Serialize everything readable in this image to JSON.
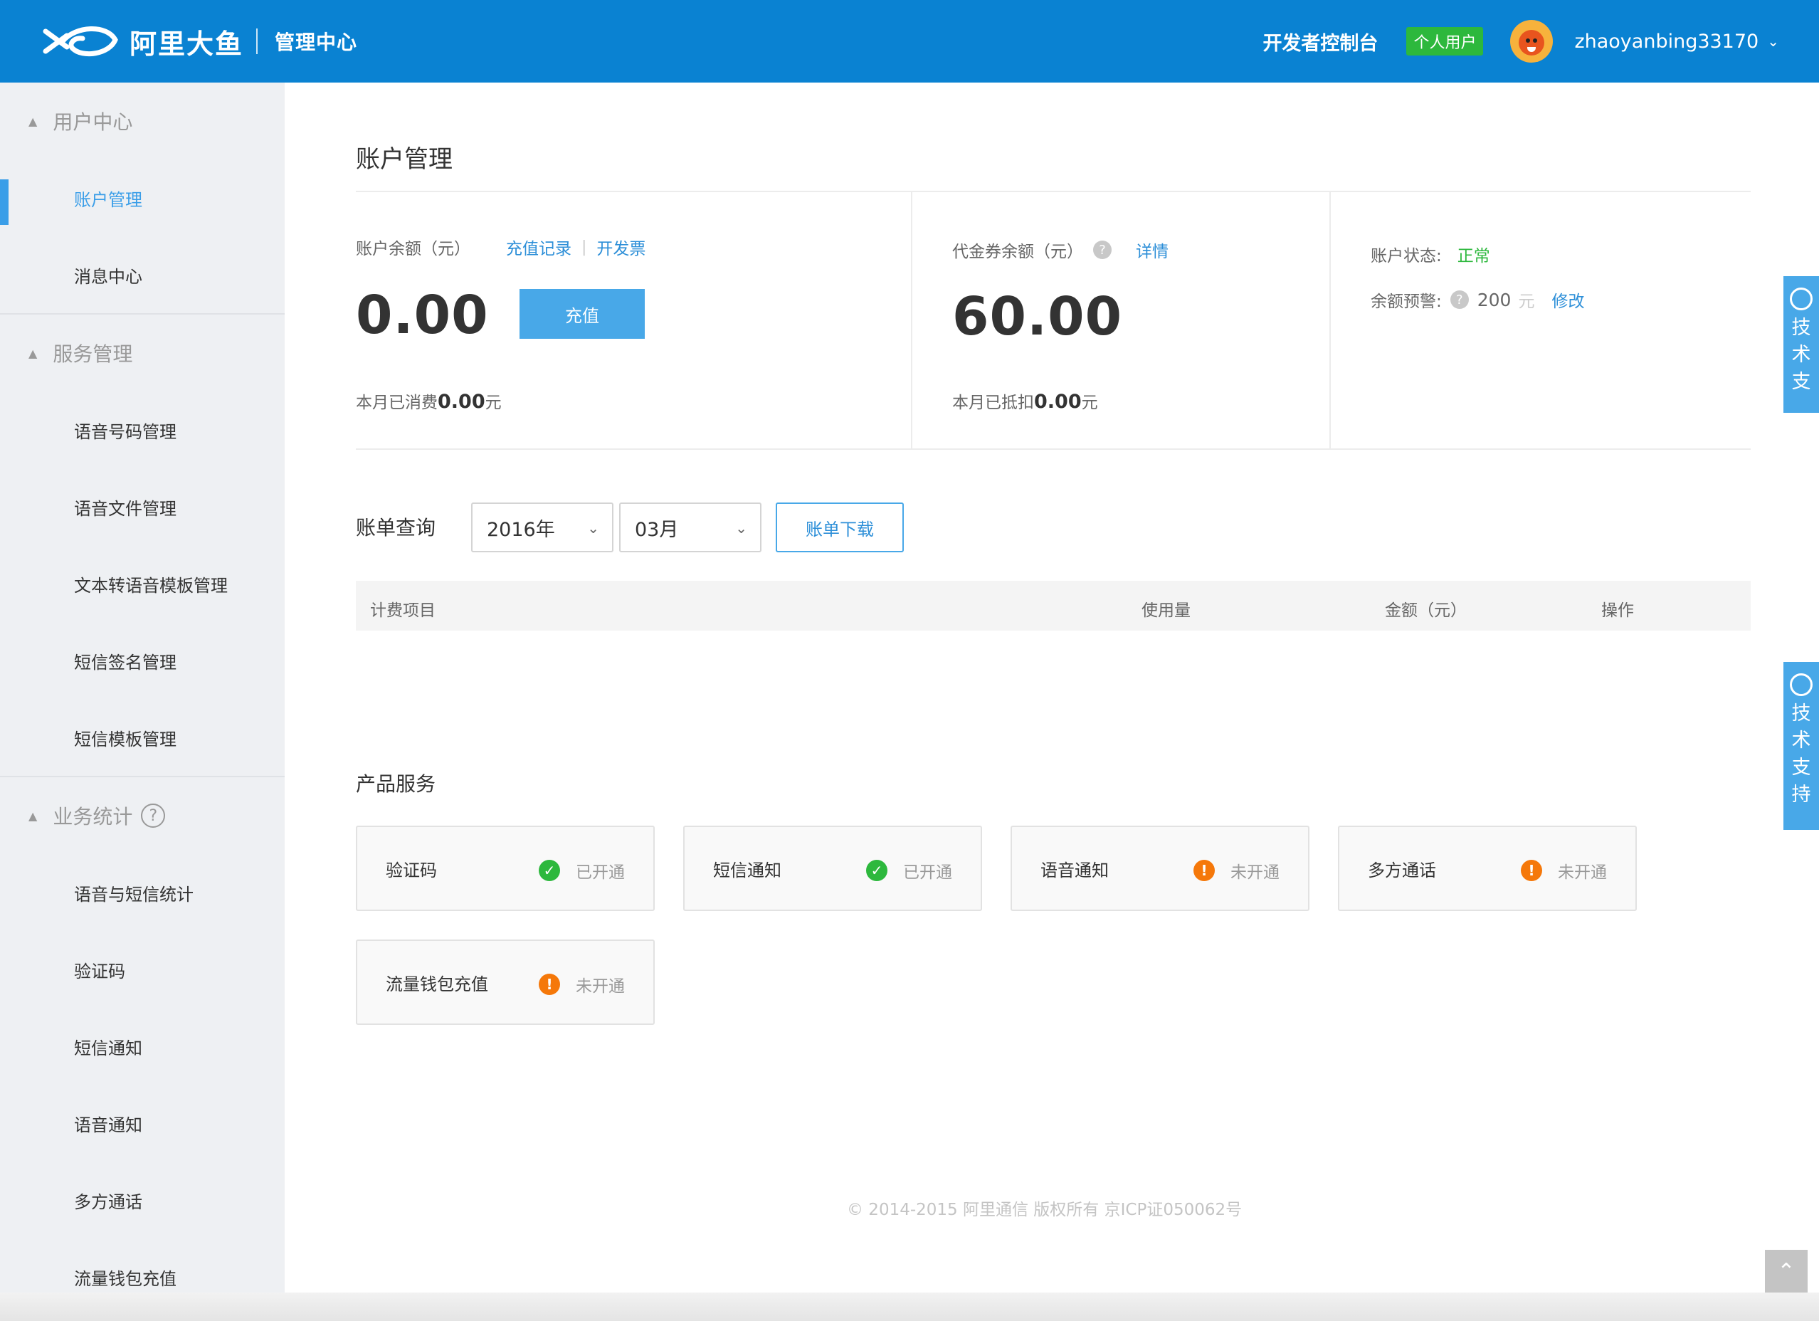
{
  "header": {
    "brand": "阿里大鱼",
    "subtitle": "管理中心",
    "dev_console": "开发者控制台",
    "user_type_badge": "个人用户",
    "username": "zhaoyanbing33170",
    "colors": {
      "bar": "#0a82d2",
      "badge": "#2db83d"
    }
  },
  "sidebar": {
    "groups": [
      {
        "title": "用户中心",
        "items": [
          "账户管理",
          "消息中心"
        ]
      },
      {
        "title": "服务管理",
        "items": [
          "语音号码管理",
          "语音文件管理",
          "文本转语音模板管理",
          "短信签名管理",
          "短信模板管理"
        ]
      },
      {
        "title": "业务统计",
        "items": [
          "语音与短信统计",
          "验证码",
          "短信通知",
          "语音通知",
          "多方通话",
          "流量钱包充值"
        ]
      }
    ],
    "active_item": "账户管理",
    "help_glyph": "?"
  },
  "account": {
    "page_title": "账户管理",
    "balance": {
      "label": "账户余额（元）",
      "recharge_record": "充值记录",
      "separator": "|",
      "invoice": "开发票",
      "amount": "0.00",
      "recharge_button": "充值",
      "month_spent_prefix": "本月已消费",
      "month_spent_value": "0.00",
      "month_spent_suffix": "元"
    },
    "voucher": {
      "label": "代金券余额（元）",
      "details": "详情",
      "amount": "60.00",
      "month_deduct_prefix": "本月已抵扣",
      "month_deduct_value": "0.00",
      "month_deduct_suffix": "元"
    },
    "status": {
      "label": "账户状态:",
      "value": "正常",
      "warn_label": "余额预警:",
      "warn_value": "200",
      "warn_unit": "元",
      "modify": "修改"
    }
  },
  "bill": {
    "label": "账单查询",
    "year": "2016年",
    "month": "03月",
    "download_button": "账单下载",
    "columns": [
      "计费项目",
      "使用量",
      "金额（元）",
      "操作"
    ],
    "rows": []
  },
  "products": {
    "title": "产品服务",
    "items": [
      {
        "name": "验证码",
        "status": "已开通",
        "state": "ok"
      },
      {
        "name": "短信通知",
        "status": "已开通",
        "state": "ok"
      },
      {
        "name": "语音通知",
        "status": "未开通",
        "state": "warn"
      },
      {
        "name": "多方通话",
        "status": "未开通",
        "state": "warn"
      },
      {
        "name": "流量钱包充值",
        "status": "未开通",
        "state": "warn"
      }
    ]
  },
  "footer": {
    "copyright": "© 2014-2015 阿里通信 版权所有 京ICP证050062号"
  },
  "support": {
    "label_tab1": "技术支",
    "label_tab2": "技术支持"
  },
  "icons": {
    "help": "?",
    "dropdown": "chevron-down-icon",
    "back_to_top": "chevron-up-icon"
  }
}
